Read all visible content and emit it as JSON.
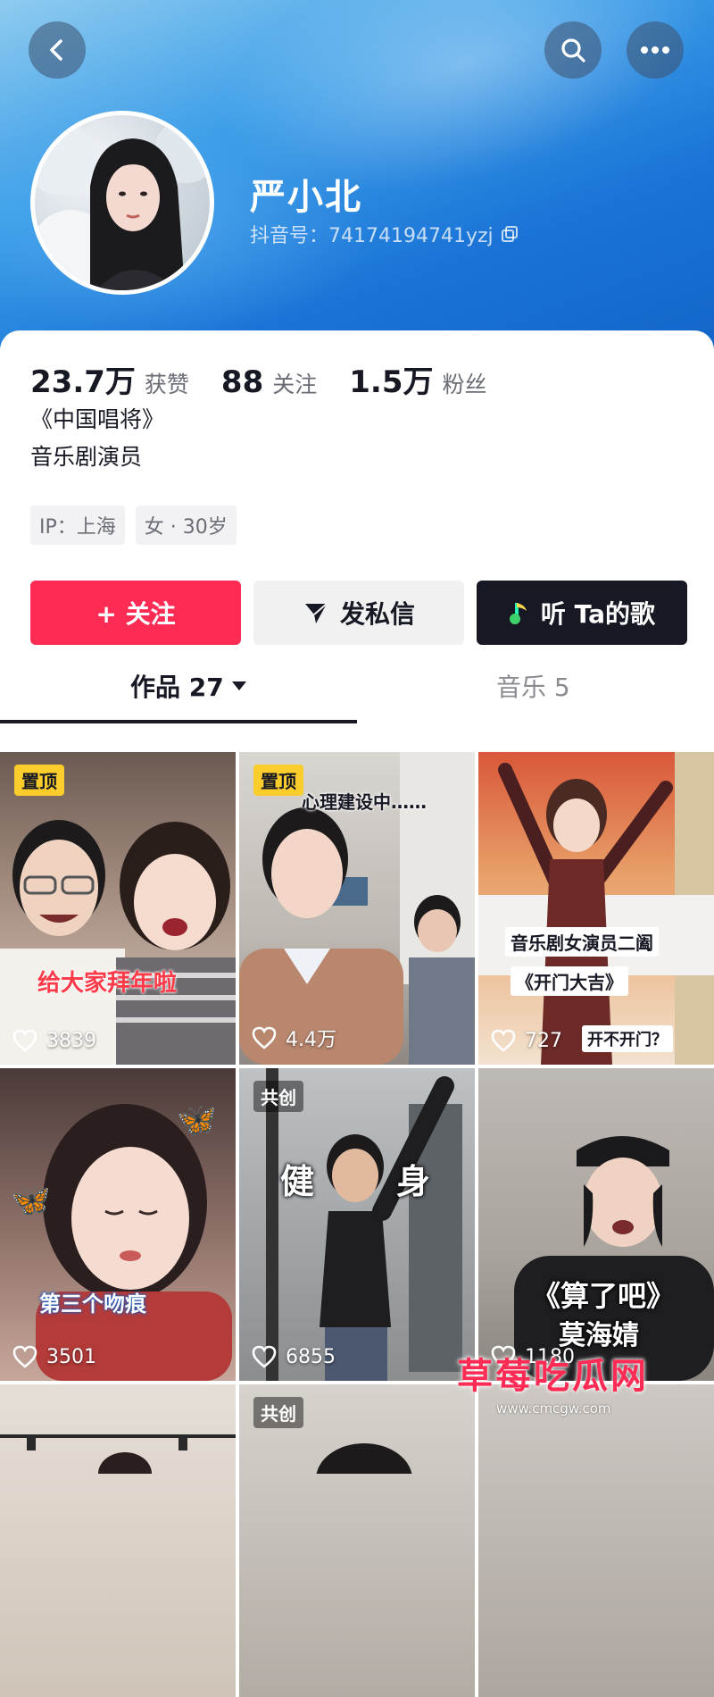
{
  "header": {
    "nickname": "严小北",
    "douyin_id": "抖音号：74174194741yzj"
  },
  "stats": [
    {
      "value": "23.7万",
      "label": "获赞"
    },
    {
      "value": "88",
      "label": "关注"
    },
    {
      "value": "1.5万",
      "label": "粉丝"
    }
  ],
  "bio": {
    "line1": "《中国唱将》",
    "line2": "音乐剧演员"
  },
  "tags": [
    "IP：上海",
    "女 · 30岁"
  ],
  "actions": {
    "follow": "+ 关注",
    "message": "发私信",
    "song": "听 Ta的歌"
  },
  "tabs": {
    "works": "作品 27",
    "music": "音乐 5"
  },
  "videos": [
    {
      "badge": "置顶",
      "likes": "3839",
      "caption": "给大家拜年啦"
    },
    {
      "badge": "置顶",
      "likes": "4.4万",
      "caption": "心理建设中……"
    },
    {
      "badge": "",
      "likes": "727",
      "caption": "音乐剧女演员二阖",
      "caption2": "《开门大吉》",
      "caption3": "开不开门？"
    },
    {
      "badge": "",
      "likes": "3501",
      "caption": "第三个吻痕"
    },
    {
      "badge": "共创",
      "likes": "6855",
      "caption": "健",
      "caption2": "身"
    },
    {
      "badge": "",
      "likes": "1180",
      "caption": "《算了吧》",
      "caption2": "莫海婧"
    },
    {
      "badge": "",
      "likes": "",
      "caption": ""
    },
    {
      "badge": "共创",
      "likes": "",
      "caption": ""
    }
  ],
  "watermark": {
    "text": "草莓吃瓜网",
    "url": "www.cmcgw.com"
  },
  "colors": {
    "accent": "#fe2c55",
    "pin_badge": "#facd2c",
    "dark_button": "#161823"
  }
}
